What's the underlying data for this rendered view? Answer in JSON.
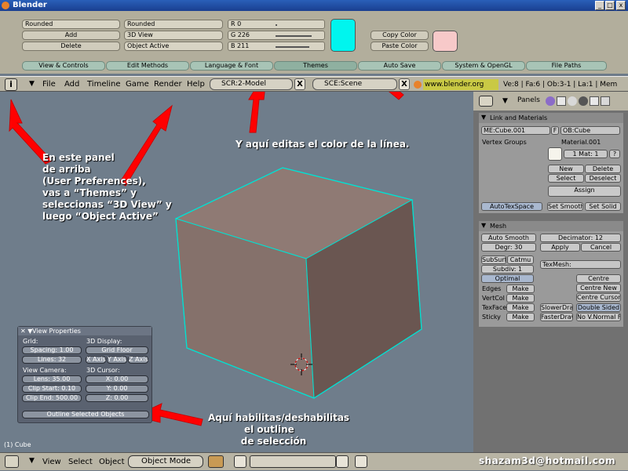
{
  "window": {
    "title": "Blender",
    "min": "_",
    "max": "□",
    "close": "x"
  },
  "prefs": {
    "left": {
      "field1": "Rounded",
      "add": "Add",
      "delete": "Delete"
    },
    "mid": {
      "field1": "Rounded",
      "field2": "3D View",
      "field3": "Object Active"
    },
    "rgb": {
      "r": "R 0",
      "g": "G 226",
      "b": "B 211",
      "r_frac": 0.0,
      "g_frac": 0.886,
      "b_frac": 0.827
    },
    "swatch_color": "#00f5ee",
    "copy_color": "Copy Color",
    "paste_color": "Paste Color",
    "swatch2_color": "#f7c9c9",
    "tabs": [
      "View & Controls",
      "Edit Methods",
      "Language & Font",
      "Themes",
      "Auto Save",
      "System & OpenGL",
      "File Paths"
    ]
  },
  "header": {
    "info_icon": "i",
    "menus": [
      "File",
      "Add",
      "Timeline",
      "Game",
      "Render",
      "Help"
    ],
    "scr": "SCR:2-Model",
    "sce": "SCE:Scene",
    "x": "X",
    "url": "www.blender.org 234",
    "stats": "Ve:8 | Fa:6 | Ob:3-1 | La:1 | Mem"
  },
  "viewport": {
    "object_label": "(1) Cube",
    "view_props": {
      "title": "View Properties",
      "grid_label": "Grid:",
      "spacing": "Spacing: 1.00",
      "lines": "Lines: 32",
      "display_label": "3D Display:",
      "grid_floor": "Grid Floor",
      "x_axis": "X Axis",
      "y_axis": "Y Axis",
      "z_axis": "Z Axis",
      "camera_label": "View Camera:",
      "lens": "Lens: 35.00",
      "clip_start": "Clip Start: 0.10",
      "clip_end": "Clip End: 500.00",
      "cursor_label": "3D Cursor:",
      "cx": "X: 0.00",
      "cy": "Y: 0.00",
      "cz": "Z: 0.00",
      "outline": "Outline Selected Objects"
    }
  },
  "annotations": {
    "a1": "En este panel\nde arriba\n(User Preferences),\nvas a “Themes” y\nseleccionas “3D View” y\nluego “Object Active”",
    "a2": "Y aquí editas el color de la línea.",
    "a3": "Aquí habilitas/deshabilitas\n           el outline\n          de selección",
    "watermark": "shazam3d@hotmail.com"
  },
  "right": {
    "panels_label": "Panels",
    "link_title": "Link and Materials",
    "me": "ME:Cube.001",
    "f": "F",
    "ob": "OB:Cube",
    "vgroups": "Vertex Groups",
    "material": "Material.001",
    "mat": "1 Mat: 1",
    "q": "?",
    "new": "New",
    "delete": "Delete",
    "select": "Select",
    "deselect": "Deselect",
    "assign": "Assign",
    "autotex": "AutoTexSpace",
    "setsmooth": "Set Smooth",
    "setsolid": "Set Solid",
    "mesh_title": "Mesh",
    "autosmooth": "Auto Smooth",
    "decimator": "Decimator: 12",
    "degr": "Degr: 30",
    "apply": "Apply",
    "cancel": "Cancel",
    "subsurf": "SubSurf",
    "catmu": "Catmu",
    "subdiv": "Subdiv: 1",
    "texmesh": "TexMesh:",
    "optimal": "Optimal",
    "centre": "Centre",
    "centrenew": "Centre New",
    "centrecursor": "Centre Cursor",
    "edges": "Edges",
    "make": "Make",
    "vertcol": "VertCol",
    "texface": "TexFace",
    "sticky": "Sticky",
    "slowerdraw": "SlowerDraw",
    "fasterdraw": "FasterDraw",
    "doublesided": "Double Sided",
    "novnormal": "No V.Normal Flip"
  },
  "bottom": {
    "view": "View",
    "select": "Select",
    "object": "Object",
    "mode": "Object Mode"
  }
}
